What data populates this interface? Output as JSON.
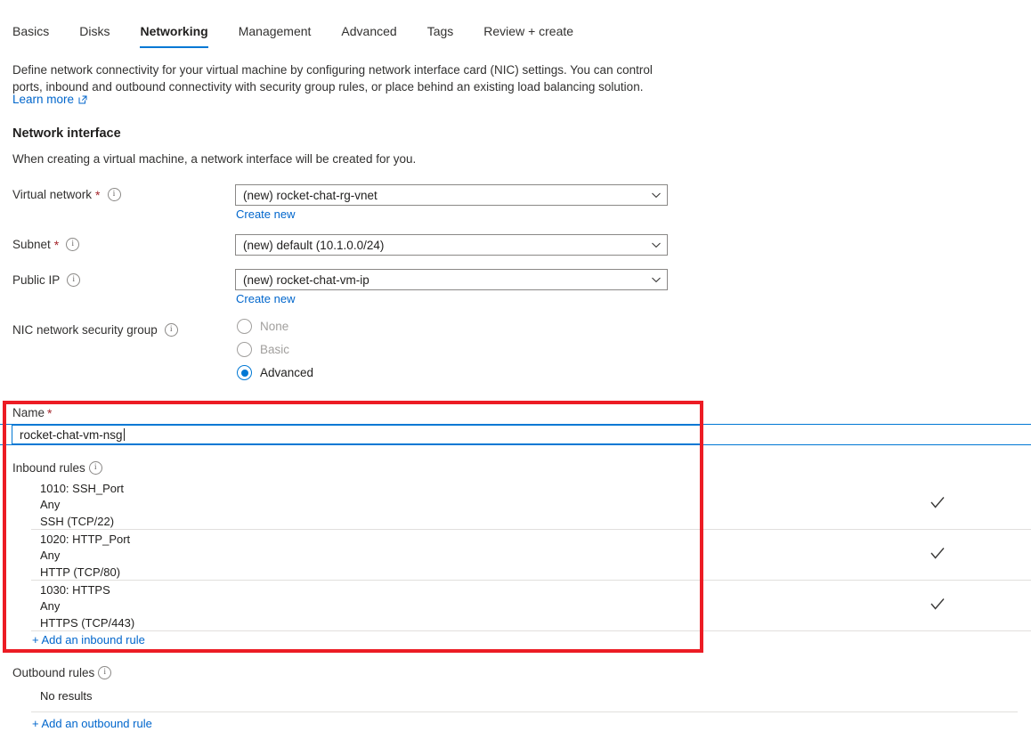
{
  "tabs": [
    {
      "label": "Basics",
      "active": false
    },
    {
      "label": "Disks",
      "active": false
    },
    {
      "label": "Networking",
      "active": true
    },
    {
      "label": "Management",
      "active": false
    },
    {
      "label": "Advanced",
      "active": false
    },
    {
      "label": "Tags",
      "active": false
    },
    {
      "label": "Review + create",
      "active": false
    }
  ],
  "intro": {
    "paragraph": "Define network connectivity for your virtual machine by configuring network interface card (NIC) settings. You can control ports, inbound and outbound connectivity with security group rules, or place behind an existing load balancing solution.",
    "learn_more": "Learn more"
  },
  "network_interface": {
    "heading": "Network interface",
    "subtext": "When creating a virtual machine, a network interface will be created for you."
  },
  "fields": {
    "virtual_network": {
      "label": "Virtual network",
      "required": true,
      "value": "(new) rocket-chat-rg-vnet",
      "create_new": "Create new"
    },
    "subnet": {
      "label": "Subnet",
      "required": true,
      "value": "(new) default (10.1.0.0/24)"
    },
    "public_ip": {
      "label": "Public IP",
      "required": false,
      "value": "(new) rocket-chat-vm-ip",
      "create_new": "Create new"
    },
    "nic_nsg": {
      "label": "NIC network security group",
      "options": [
        {
          "label": "None",
          "selected": false,
          "disabled": true
        },
        {
          "label": "Basic",
          "selected": false,
          "disabled": true
        },
        {
          "label": "Advanced",
          "selected": true,
          "disabled": false
        }
      ]
    }
  },
  "nsg": {
    "name": {
      "label": "Name",
      "required": true,
      "value": "rocket-chat-vm-nsg"
    },
    "inbound": {
      "label": "Inbound rules",
      "rules": [
        {
          "priority_name": "1010: SSH_Port",
          "source": "Any",
          "port": "SSH (TCP/22)",
          "checked": true
        },
        {
          "priority_name": "1020: HTTP_Port",
          "source": "Any",
          "port": "HTTP (TCP/80)",
          "checked": true
        },
        {
          "priority_name": "1030: HTTPS",
          "source": "Any",
          "port": "HTTPS (TCP/443)",
          "checked": true
        }
      ],
      "add_link": "+ Add an inbound rule"
    },
    "outbound": {
      "label": "Outbound rules",
      "empty_text": "No results",
      "add_link": "+ Add an outbound rule"
    }
  },
  "colors": {
    "accent": "#0078d4",
    "link": "#0066cc",
    "required": "#a4262c",
    "highlight": "#ec1c24",
    "divider": "#e1dfdd"
  }
}
